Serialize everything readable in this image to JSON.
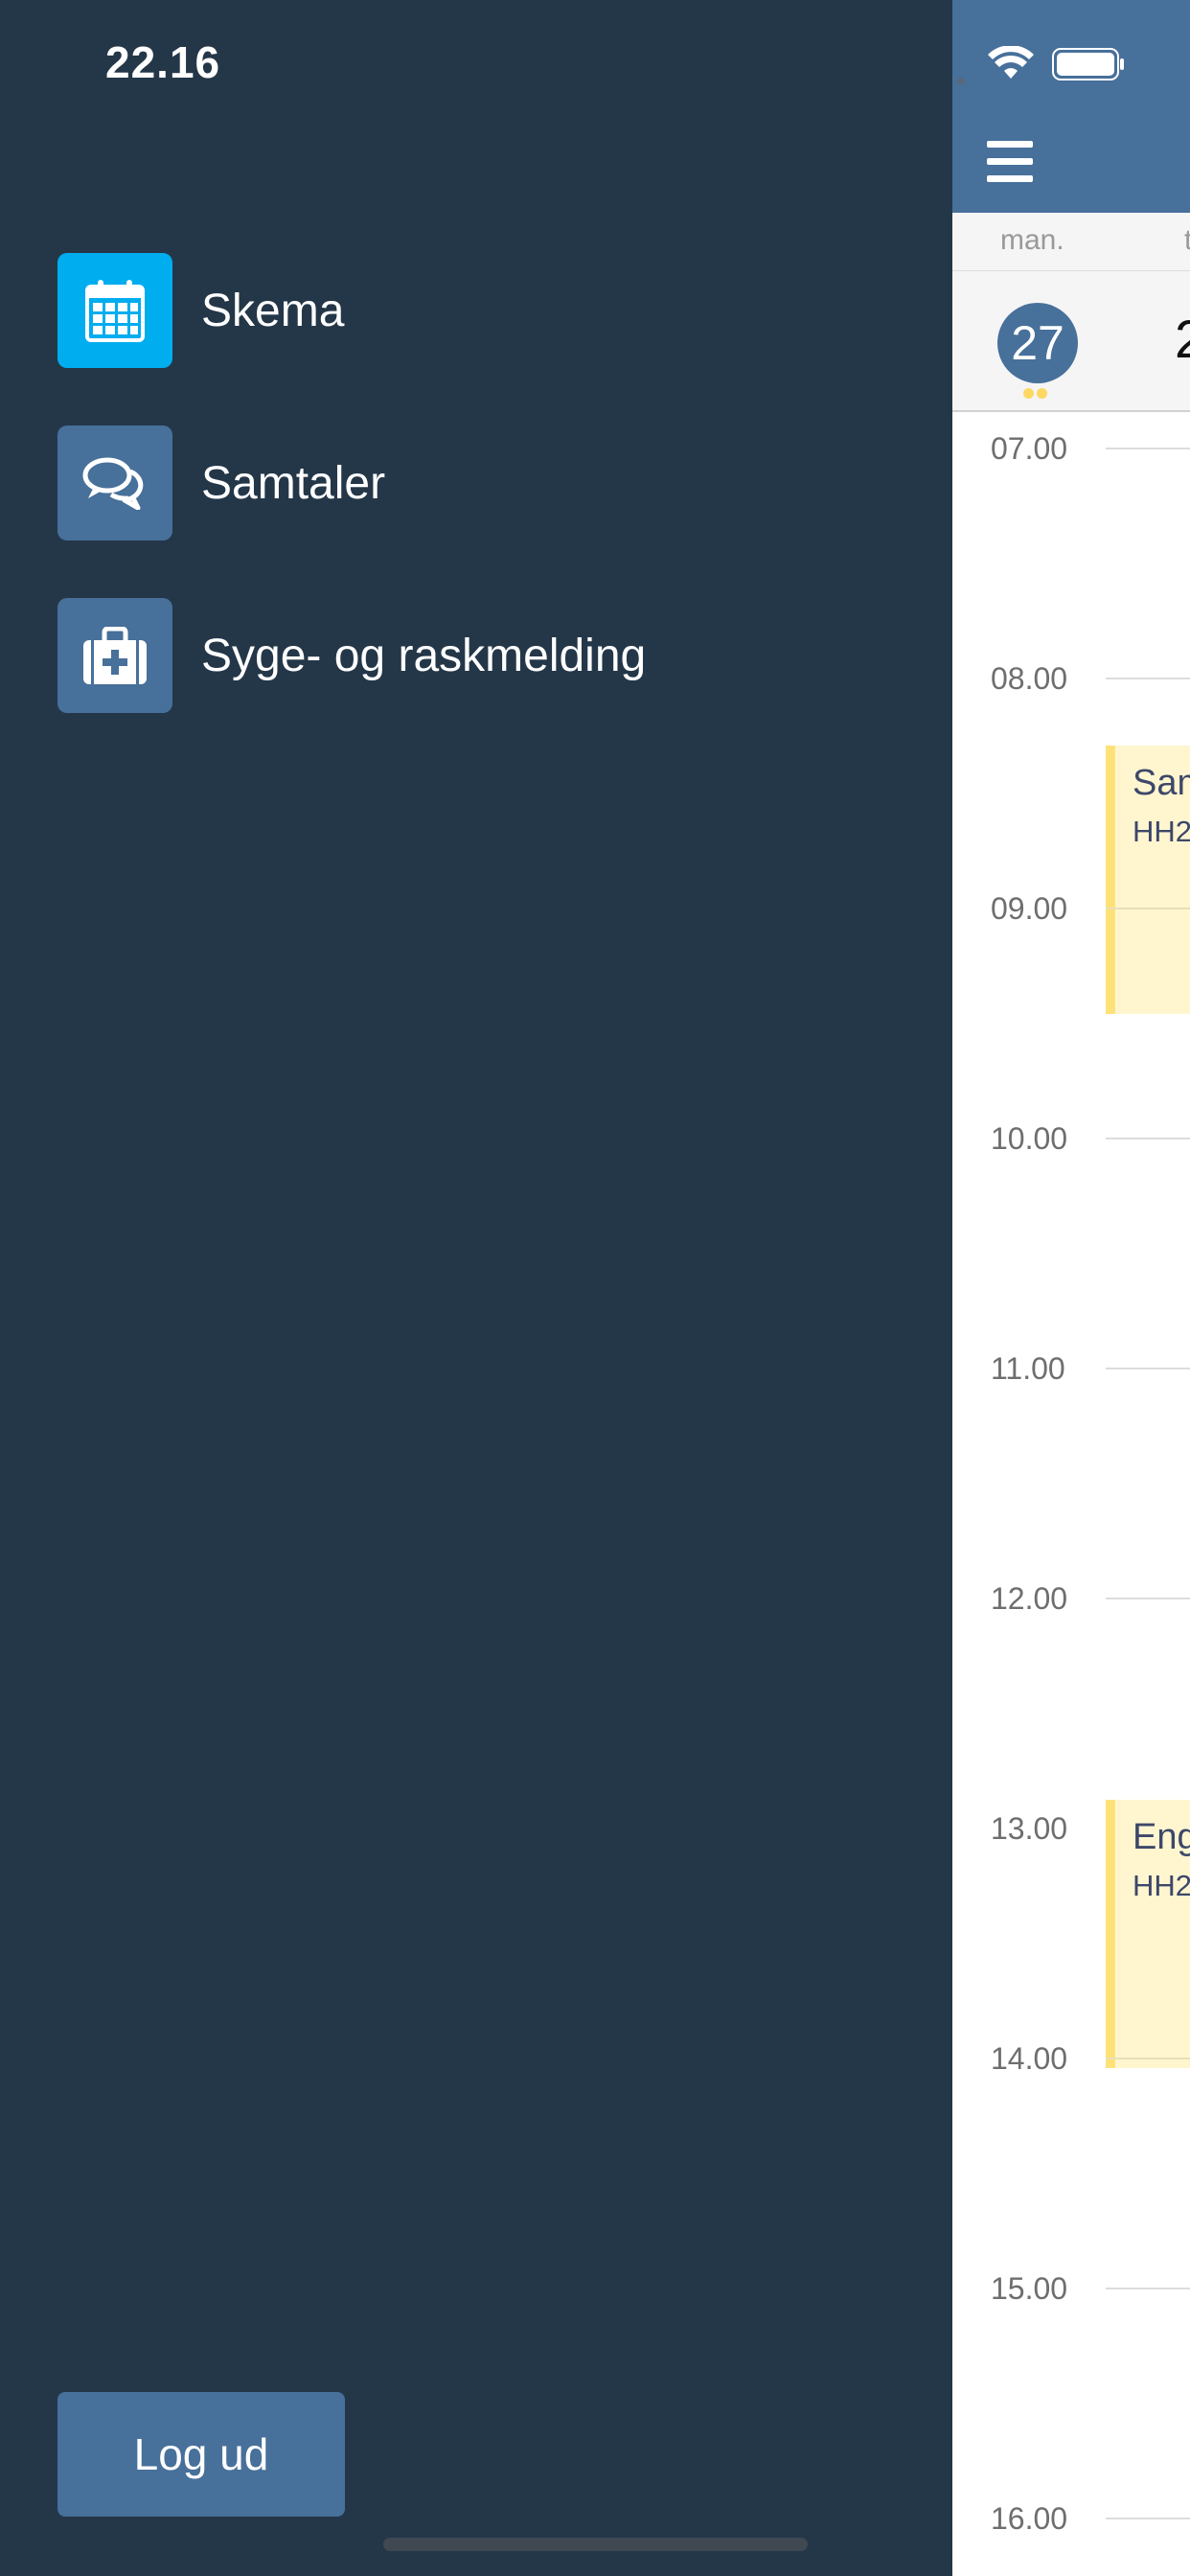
{
  "status_bar": {
    "time": "22.16"
  },
  "drawer": {
    "items": [
      {
        "label": "Skema",
        "icon": "calendar-icon",
        "active": true
      },
      {
        "label": "Samtaler",
        "icon": "chat-bubbles-icon",
        "active": false
      },
      {
        "label": "Syge- og raskmelding",
        "icon": "medical-kit-icon",
        "active": false
      }
    ],
    "logout_label": "Log ud"
  },
  "calendar": {
    "weekday": "man.",
    "weekday_next": "t",
    "selected_date": "27",
    "next_date": "2",
    "hours": [
      "07.00",
      "08.00",
      "09.00",
      "10.00",
      "11.00",
      "12.00",
      "13.00",
      "14.00",
      "15.00",
      "16.00"
    ],
    "events": [
      {
        "title": "Sam",
        "sub": "HH2"
      },
      {
        "title": "Eng",
        "sub": "HH2"
      }
    ]
  },
  "colors": {
    "drawer_bg": "#243749",
    "accent_active": "#00adef",
    "accent": "#47709a",
    "event_bg": "#fff6cf",
    "event_border": "#fde278"
  }
}
